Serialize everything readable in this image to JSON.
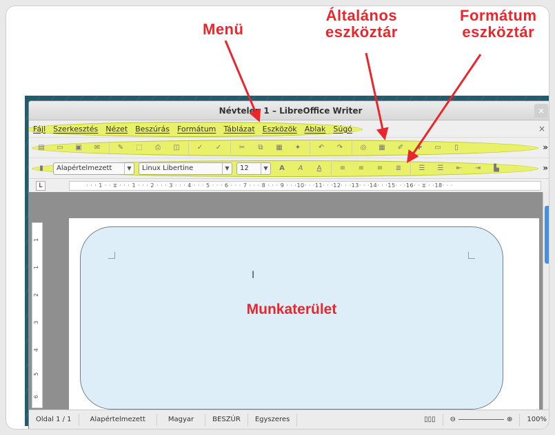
{
  "annotations": {
    "menu": "Menü",
    "general_toolbar_line1": "Általános",
    "general_toolbar_line2": "eszköztár",
    "format_toolbar_line1": "Formátum",
    "format_toolbar_line2": "eszköztár",
    "workspace": "Munkaterület"
  },
  "window": {
    "title": "Névtelen 1 – LibreOffice Writer",
    "close_symbol": "×"
  },
  "menu": {
    "items": [
      "Fájl",
      "Szerkesztés",
      "Nézet",
      "Beszúrás",
      "Formátum",
      "Táblázat",
      "Eszközök",
      "Ablak",
      "Súgó"
    ],
    "close_symbol": "×"
  },
  "format_toolbar": {
    "paragraph_style": "Alapértelmezett",
    "font_name": "Linux Libertine",
    "font_size": "12"
  },
  "ruler": {
    "marks": "· · · 1 · · ⧖ · · · 1 · · · 2 · · · 3 · · · 4 · · · 5 · · · 6 · · · 7 · · · 8 · · · 9 · · ·10· · ·11· · ·12· · ·13· · ·14· · ·15· · ·16· · ⧖ · ·18· · ·"
  },
  "vertical_ruler": [
    "1",
    "1",
    "2",
    "3",
    "4",
    "5",
    "6"
  ],
  "statusbar": {
    "page": "Oldal 1 / 1",
    "style": "Alapértelmezett",
    "language": "Magyar",
    "insert_mode": "BESZÚR",
    "selection_mode": "Egyszeres",
    "zoom": "100%"
  },
  "colors": {
    "annotation_red": "#e8262b",
    "highlight_yellow": "#e8f24e",
    "canvas_fill": "#ddeef8",
    "scroll_thumb": "#4a90d9"
  }
}
